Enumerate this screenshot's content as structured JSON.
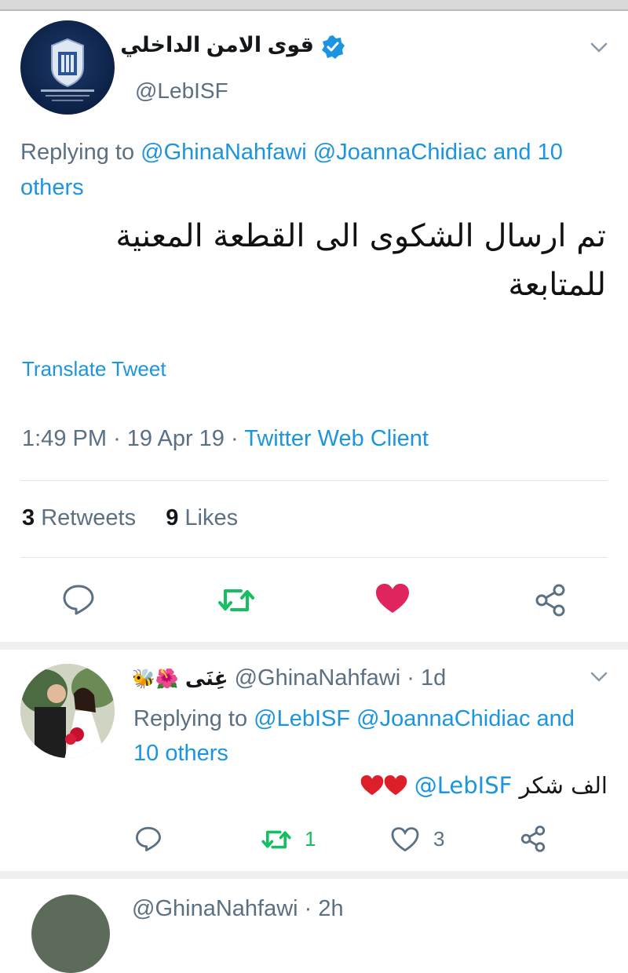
{
  "tweet": {
    "display_name": "قوى الامن الداخلي",
    "handle": "@LebISF",
    "replying_prefix": "Replying to ",
    "replying_users": "@GhinaNahfawi @JoannaChidiac and 10 others",
    "text": "تم ارسال الشكوى الى القطعة المعنية للمتابعة",
    "translate_label": "Translate Tweet",
    "time": "1:49 PM",
    "date": "19 Apr 19",
    "client": "Twitter Web Client",
    "retweet_count": "3",
    "retweet_label": "Retweets",
    "like_count": "9",
    "like_label": "Likes",
    "liked": true
  },
  "reply": {
    "display_name": "غِنَى",
    "handle": "@GhinaNahfawi",
    "age": "1d",
    "replying_prefix": "Replying to ",
    "replying_users": "@LebISF @JoannaChidiac and 10 others",
    "text_arabic": "الف شكر",
    "text_mention": "@LebISF",
    "retweet_count": "1",
    "like_count": "3"
  },
  "next_reply": {
    "handle": "@GhinaNahfawi",
    "age": "2h"
  },
  "colors": {
    "link": "#1b95e0",
    "muted": "#5b7083",
    "retweet_green": "#17bf63",
    "like_red": "#e0245e"
  },
  "icons": [
    "verified-badge-icon",
    "chevron-down-icon",
    "reply-icon",
    "retweet-icon",
    "like-icon",
    "share-icon",
    "heart-emoji",
    "hibiscus-emoji",
    "bee-emoji"
  ]
}
